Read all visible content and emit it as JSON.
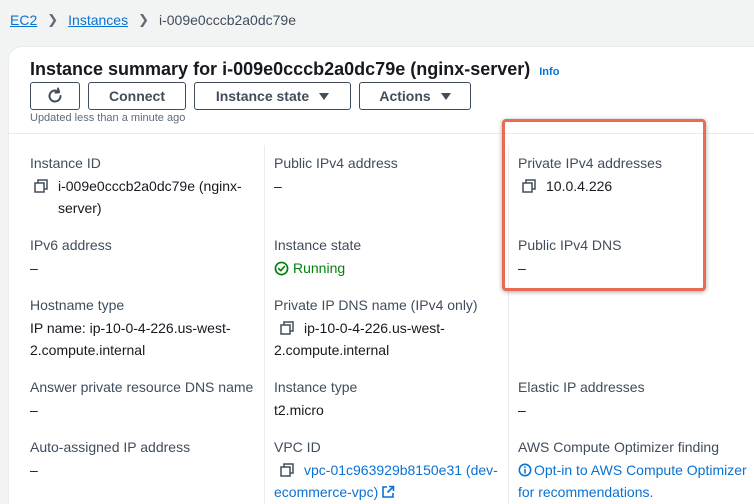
{
  "breadcrumb": {
    "ec2": "EC2",
    "instances": "Instances",
    "current": "i-009e0cccb2a0dc79e"
  },
  "summary": {
    "title": "Instance summary for i-009e0cccb2a0dc79e (nginx-server)",
    "info": "Info",
    "updated": "Updated less than a minute ago"
  },
  "toolbar": {
    "refresh_icon": "refresh-icon",
    "connect": "Connect",
    "instance_state": "Instance state",
    "actions": "Actions"
  },
  "details": {
    "instance_id": {
      "label": "Instance ID",
      "value": "i-009e0cccb2a0dc79e (nginx-server)"
    },
    "public_ipv4": {
      "label": "Public IPv4 address",
      "value": "–"
    },
    "private_ipv4": {
      "label": "Private IPv4 addresses",
      "value": "10.0.4.226"
    },
    "ipv6": {
      "label": "IPv6 address",
      "value": "–"
    },
    "instance_state": {
      "label": "Instance state",
      "value": "Running"
    },
    "public_dns": {
      "label": "Public IPv4 DNS",
      "value": "–"
    },
    "hostname_type": {
      "label": "Hostname type",
      "value": "IP name: ip-10-0-4-226.us-west-2.compute.internal"
    },
    "private_dns": {
      "label": "Private IP DNS name (IPv4 only)",
      "value": "ip-10-0-4-226.us-west-2.compute.internal"
    },
    "answer_private_dns": {
      "label": "Answer private resource DNS name",
      "value": "–"
    },
    "instance_type": {
      "label": "Instance type",
      "value": "t2.micro"
    },
    "elastic_ip": {
      "label": "Elastic IP addresses",
      "value": "–"
    },
    "auto_ip": {
      "label": "Auto-assigned IP address",
      "value": "–"
    },
    "vpc_id": {
      "label": "VPC ID",
      "value": "vpc-01c963929b8150e31 (dev-ecommerce-vpc)"
    },
    "optimizer": {
      "label": "AWS Compute Optimizer finding",
      "value": "Opt-in to AWS Compute Optimizer for recommendations."
    }
  },
  "colors": {
    "link": "#0972d3",
    "running": "#037f0c",
    "highlight": "#e86b55"
  }
}
